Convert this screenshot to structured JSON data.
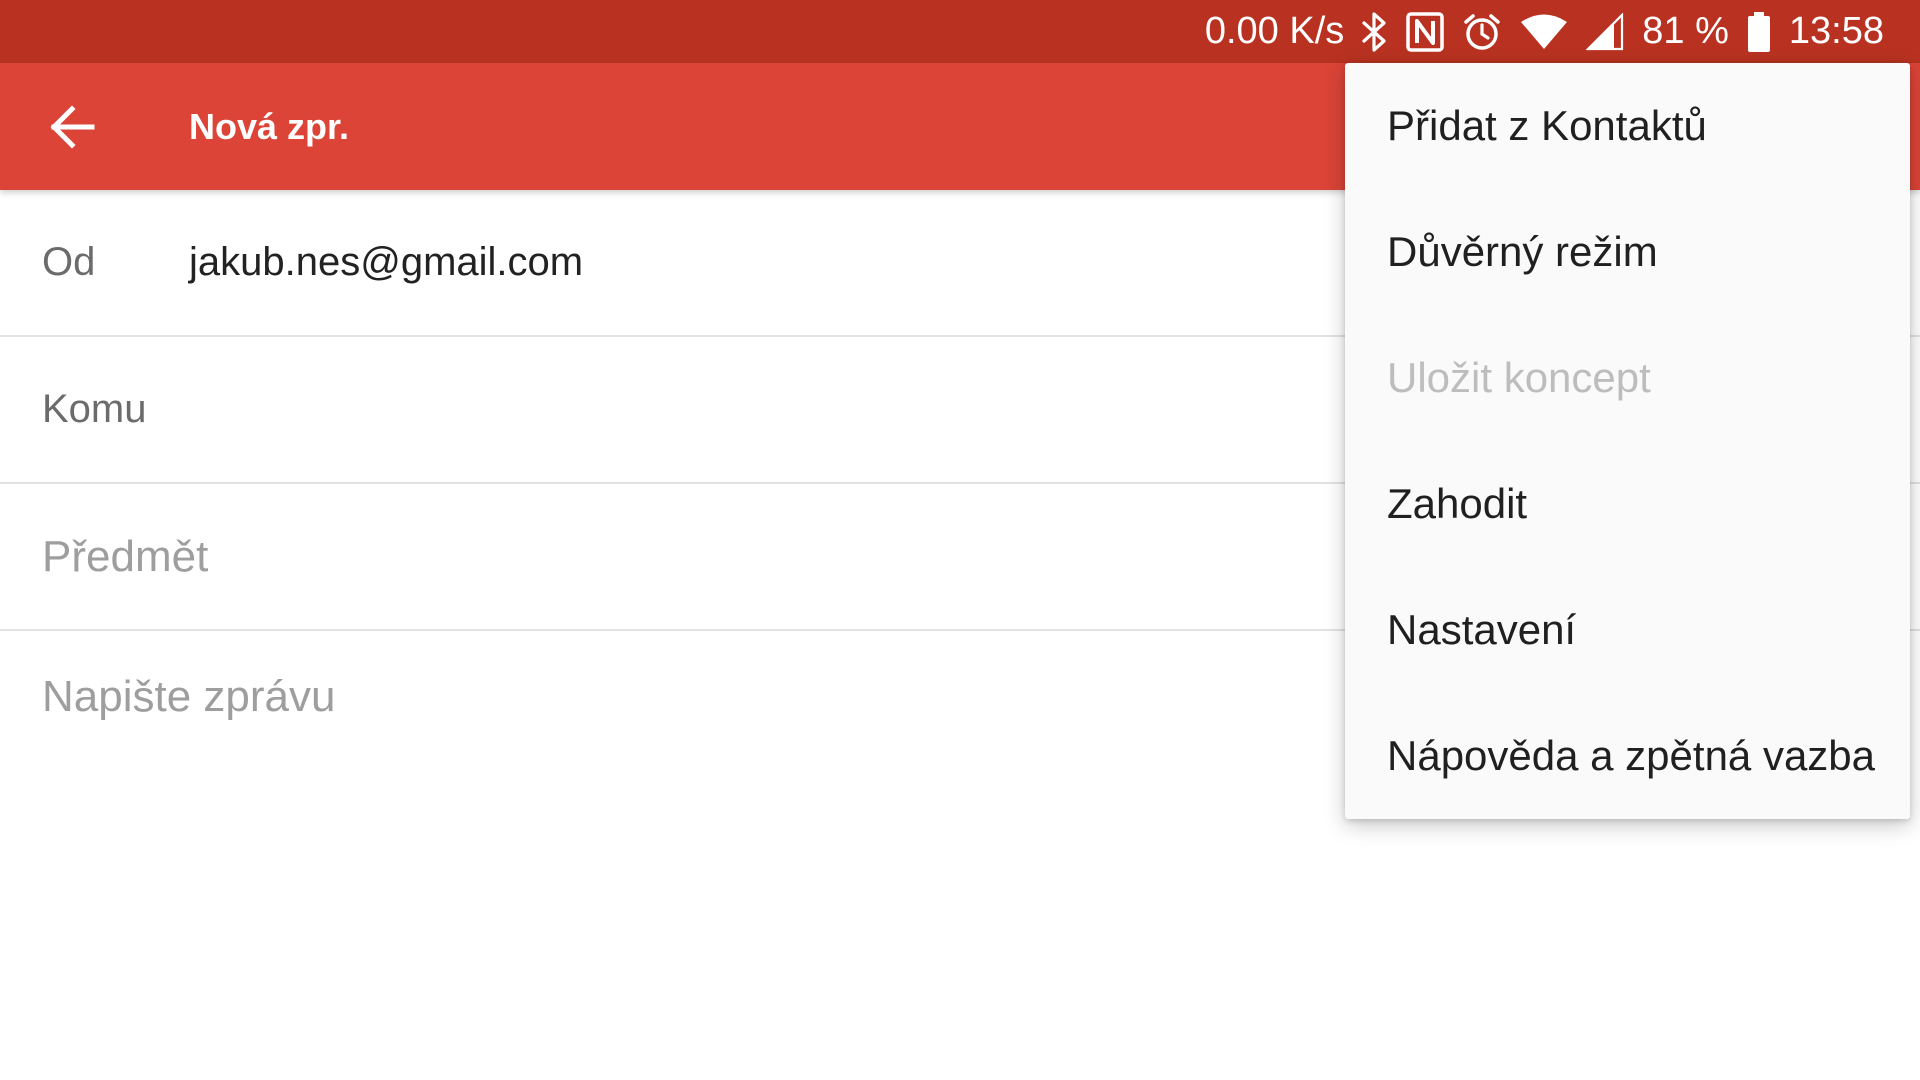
{
  "status_bar": {
    "net_speed": "0.00 K/s",
    "battery": "81 %",
    "time": "13:58",
    "icons": [
      "bluetooth-icon",
      "nfc-icon",
      "alarm-icon",
      "wifi-icon",
      "cell-signal-icon",
      "battery-icon"
    ]
  },
  "app_bar": {
    "back_icon": "arrow-back-icon",
    "title": "Nová zpr."
  },
  "compose": {
    "from_label": "Od",
    "from_value": "jakub.nes@gmail.com",
    "to_label": "Komu",
    "subject_placeholder": "Předmět",
    "body_placeholder": "Napište zprávu"
  },
  "menu": {
    "items": [
      {
        "label": "Přidat z Kontaktů",
        "enabled": true
      },
      {
        "label": "Důvěrný režim",
        "enabled": true
      },
      {
        "label": "Uložit koncept",
        "enabled": false
      },
      {
        "label": "Zahodit",
        "enabled": true
      },
      {
        "label": "Nastavení",
        "enabled": true
      },
      {
        "label": "Nápověda a zpětná vazba",
        "enabled": true
      }
    ]
  },
  "colors": {
    "status_bar": "#b93221",
    "app_bar": "#db4437",
    "menu_bg": "#fafafa",
    "disabled_text": "#bdbdbd"
  }
}
